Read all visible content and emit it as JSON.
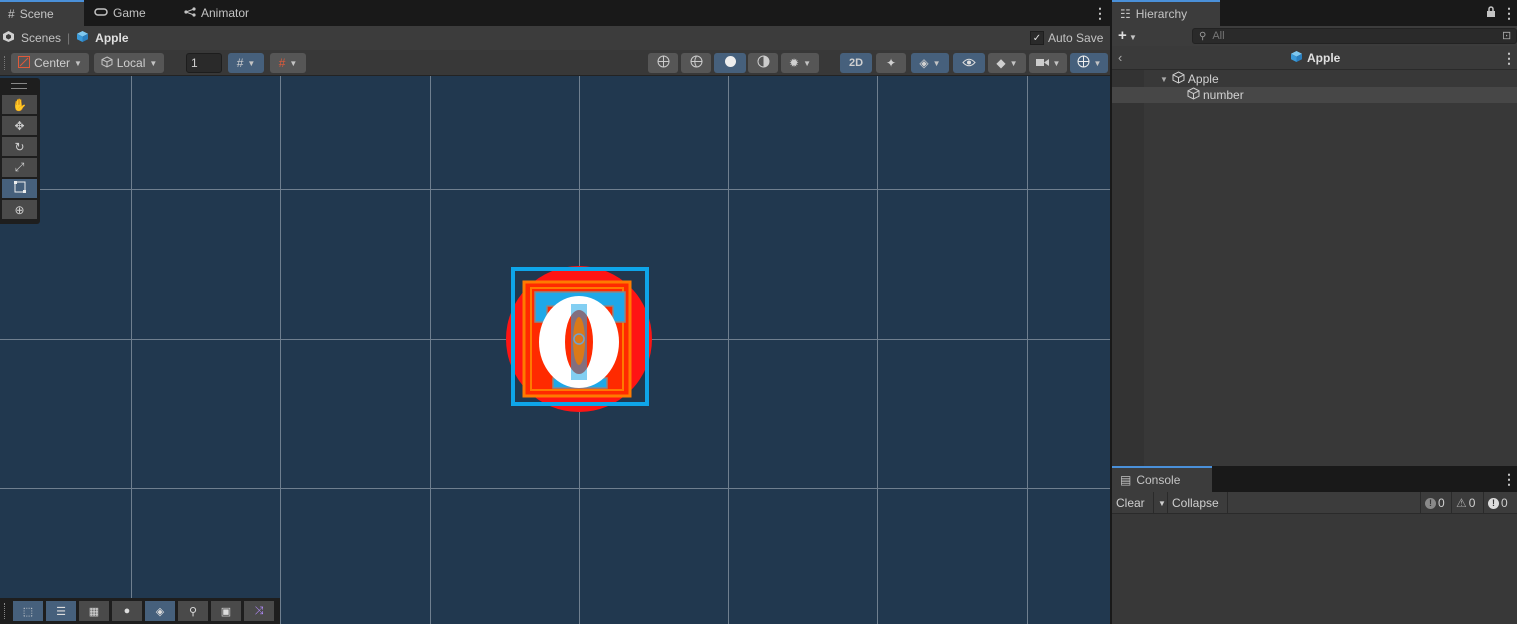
{
  "scene_tabs": [
    {
      "label": "Scene",
      "icon": "grid-icon",
      "active": true
    },
    {
      "label": "Game",
      "icon": "gamepad-icon",
      "active": false
    },
    {
      "label": "Animator",
      "icon": "animator-icon",
      "active": false
    }
  ],
  "breadcrumb": {
    "root": "Scenes",
    "current": "Apple"
  },
  "autosave": {
    "label": "Auto Save",
    "checked": true
  },
  "toolbar": {
    "pivot_label": "Center",
    "space_label": "Local",
    "grid_size_value": "1",
    "mode_2d_label": "2D"
  },
  "tools": [
    "hand-tool",
    "move-tool",
    "rotate-tool",
    "scale-tool",
    "rect-tool",
    "transform-tool"
  ],
  "hierarchy": {
    "tab_label": "Hierarchy",
    "search_placeholder": "All",
    "header_title": "Apple",
    "items": [
      {
        "label": "Apple",
        "depth": 0,
        "expanded": true,
        "selected": false
      },
      {
        "label": "number",
        "depth": 1,
        "expanded": false,
        "selected": true
      }
    ]
  },
  "console": {
    "tab_label": "Console",
    "clear_label": "Clear",
    "collapse_label": "Collapse",
    "log_count": "0",
    "warning_count": "0",
    "error_count": "0"
  },
  "colors": {
    "accent": "#46607c",
    "viewport": "#21384f",
    "selection_outline": "#0ea5e9",
    "apple_red": "#ff0000"
  }
}
